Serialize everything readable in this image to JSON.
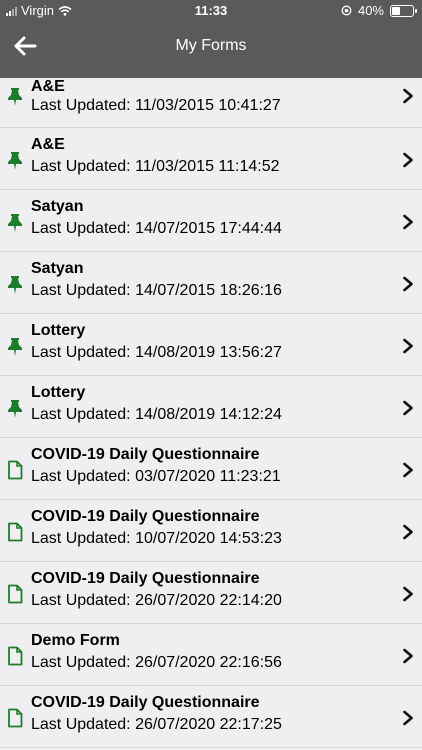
{
  "status_bar": {
    "carrier": "Virgin",
    "time": "11:33",
    "battery": "40%",
    "battery_level": 0.4
  },
  "nav": {
    "title": "My Forms",
    "back_icon": "arrow-left-icon"
  },
  "forms": [
    {
      "name": "A&E",
      "updated": "Last Updated: 11/03/2015 10:41:27",
      "icon": "pin-icon"
    },
    {
      "name": "A&E",
      "updated": "Last Updated: 11/03/2015 11:14:52",
      "icon": "pin-icon"
    },
    {
      "name": "Satyan",
      "updated": "Last Updated: 14/07/2015 17:44:44",
      "icon": "pin-icon"
    },
    {
      "name": "Satyan",
      "updated": "Last Updated: 14/07/2015 18:26:16",
      "icon": "pin-icon"
    },
    {
      "name": "Lottery",
      "updated": "Last Updated: 14/08/2019 13:56:27",
      "icon": "pin-icon"
    },
    {
      "name": "Lottery",
      "updated": "Last Updated: 14/08/2019 14:12:24",
      "icon": "pin-icon"
    },
    {
      "name": "COVID-19 Daily Questionnaire",
      "updated": "Last Updated: 03/07/2020 11:23:21",
      "icon": "document-icon"
    },
    {
      "name": "COVID-19 Daily Questionnaire",
      "updated": "Last Updated: 10/07/2020 14:53:23",
      "icon": "document-icon"
    },
    {
      "name": "COVID-19 Daily Questionnaire",
      "updated": "Last Updated: 26/07/2020 22:14:20",
      "icon": "document-icon"
    },
    {
      "name": "Demo Form",
      "updated": "Last Updated: 26/07/2020 22:16:56",
      "icon": "document-icon"
    },
    {
      "name": "COVID-19 Daily Questionnaire",
      "updated": "Last Updated: 26/07/2020 22:17:25",
      "icon": "document-icon"
    }
  ],
  "colors": {
    "header": "#5a5a5a",
    "icon_green": "#1e7d2b",
    "background": "#efeef0"
  }
}
